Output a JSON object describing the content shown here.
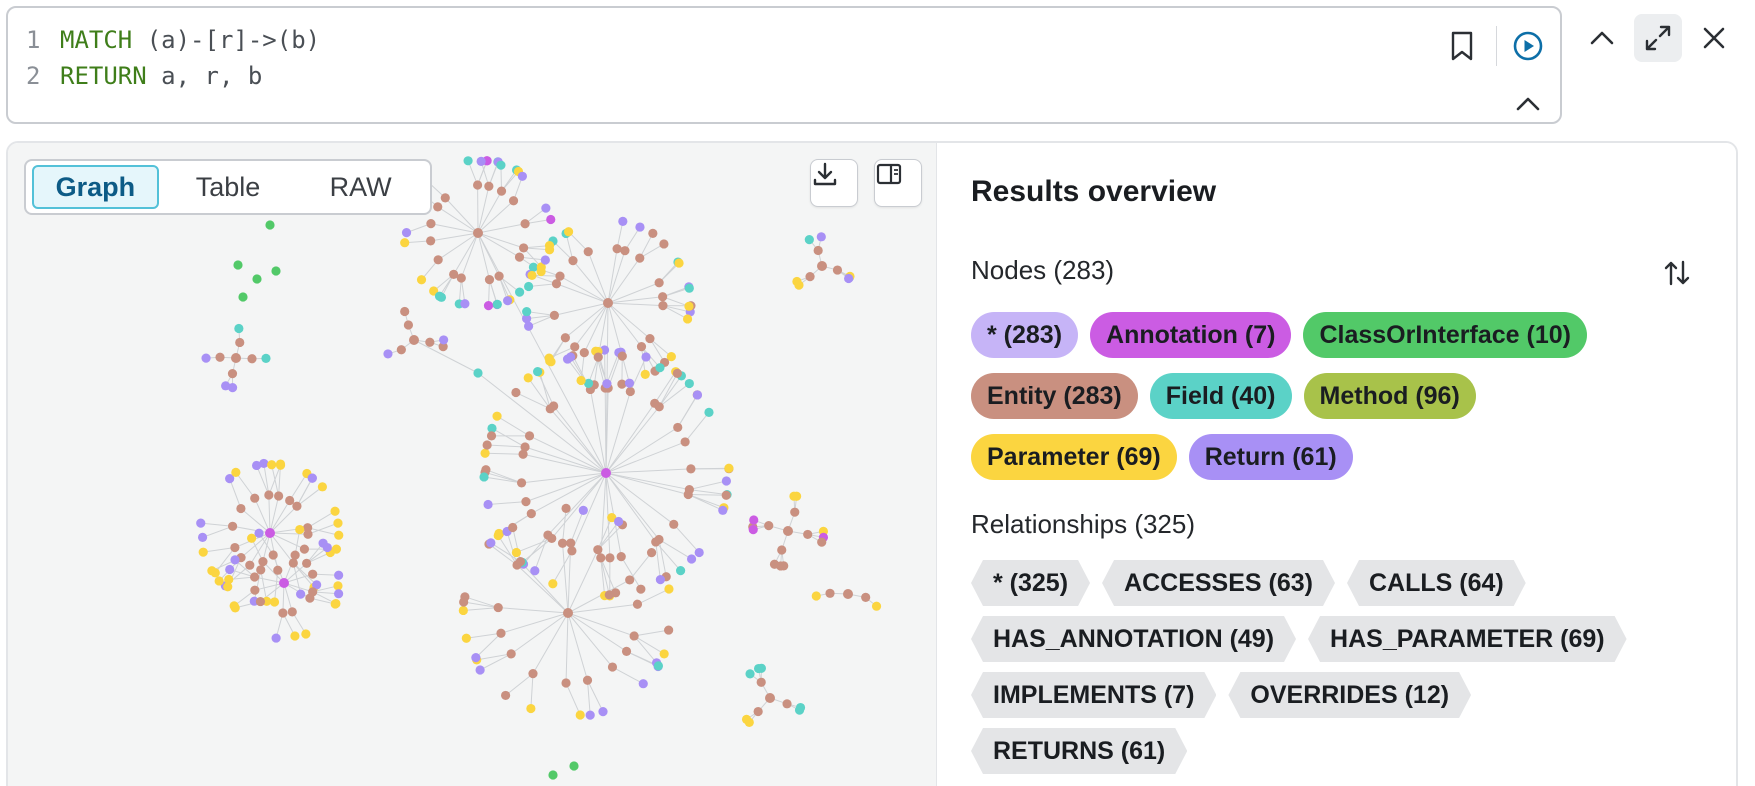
{
  "editor": {
    "lines": [
      {
        "num": "1",
        "keyword": "MATCH",
        "rest": " (a)-[r]->(b)"
      },
      {
        "num": "2",
        "keyword": "RETURN",
        "rest": " a, r, b"
      }
    ],
    "buttons": {
      "favorite": "bookmark-icon",
      "run": "play-circle-icon",
      "collapse_editor": "chevron-up-icon"
    }
  },
  "frame_controls": {
    "collapse": "chevron-up-icon",
    "fullscreen": "expand-icon",
    "close": "close-icon"
  },
  "view_tabs": [
    {
      "label": "Graph",
      "active": true
    },
    {
      "label": "Table",
      "active": false
    },
    {
      "label": "RAW",
      "active": false
    }
  ],
  "canvas_buttons": {
    "download": "download-icon",
    "toggle_panel": "sidebar-toggle-icon"
  },
  "overview": {
    "title": "Results overview",
    "nodes_label": "Nodes (283)",
    "relationships_label": "Relationships (325)",
    "node_chips": [
      {
        "label": "* (283)",
        "color": "#c6b4f7"
      },
      {
        "label": "Annotation (7)",
        "color": "#cb5ce3"
      },
      {
        "label": "ClassOrInterface (10)",
        "color": "#52c968"
      },
      {
        "label": "Entity (283)",
        "color": "#c99080"
      },
      {
        "label": "Field (40)",
        "color": "#5bd2c7"
      },
      {
        "label": "Method (96)",
        "color": "#a8c24a"
      },
      {
        "label": "Parameter (69)",
        "color": "#fbd540"
      },
      {
        "label": "Return (61)",
        "color": "#a890f5"
      }
    ],
    "relationship_chips": [
      {
        "label": "* (325)"
      },
      {
        "label": "ACCESSES (63)"
      },
      {
        "label": "CALLS (64)"
      },
      {
        "label": "HAS_ANNOTATION (49)"
      },
      {
        "label": "HAS_PARAMETER (69)"
      },
      {
        "label": "IMPLEMENTS (7)"
      },
      {
        "label": "OVERRIDES (12)"
      },
      {
        "label": "RETURNS (61)"
      }
    ]
  },
  "colors": {
    "keyword": "#3f7e1a",
    "run_button": "#0d6fa8",
    "node_entity": "#c99080",
    "node_parameter": "#fbd540",
    "node_return": "#a890f5",
    "node_field": "#5bd2c7",
    "node_annotation": "#cb5ce3",
    "node_class": "#52c968"
  }
}
